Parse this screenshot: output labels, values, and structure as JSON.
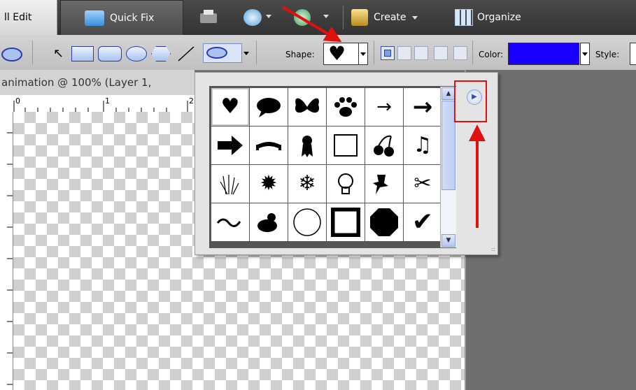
{
  "modebar": {
    "tabs": [
      {
        "label": "ll Edit",
        "active": true
      },
      {
        "label": "Quick Fix",
        "active": false
      }
    ],
    "create_label": "Create",
    "organize_label": "Organize"
  },
  "options": {
    "shape_label": "Shape:",
    "color_label": "Color:",
    "style_label": "Style:",
    "color_value": "#1a00ff"
  },
  "document": {
    "title": "animation @ 100% (Layer 1,",
    "ruler_labels": [
      "0",
      "1",
      "2"
    ]
  },
  "shape_picker": {
    "shapes": [
      [
        "heart",
        "speech-bubble",
        "butterfly",
        "paw-print",
        "thin-arrow",
        "arrow"
      ],
      [
        "bold-arrow",
        "banner",
        "ribbon",
        "frame",
        "cherries",
        "music-notes"
      ],
      [
        "grass",
        "starburst",
        "snowflake",
        "lightbulb",
        "pushpin",
        "scissors"
      ],
      [
        "swirl",
        "floral",
        "circle-frame",
        "square-frame",
        "octagon",
        "checkmark"
      ]
    ],
    "selected": "heart"
  },
  "annotations": {
    "highlight_color": "#e01010"
  }
}
